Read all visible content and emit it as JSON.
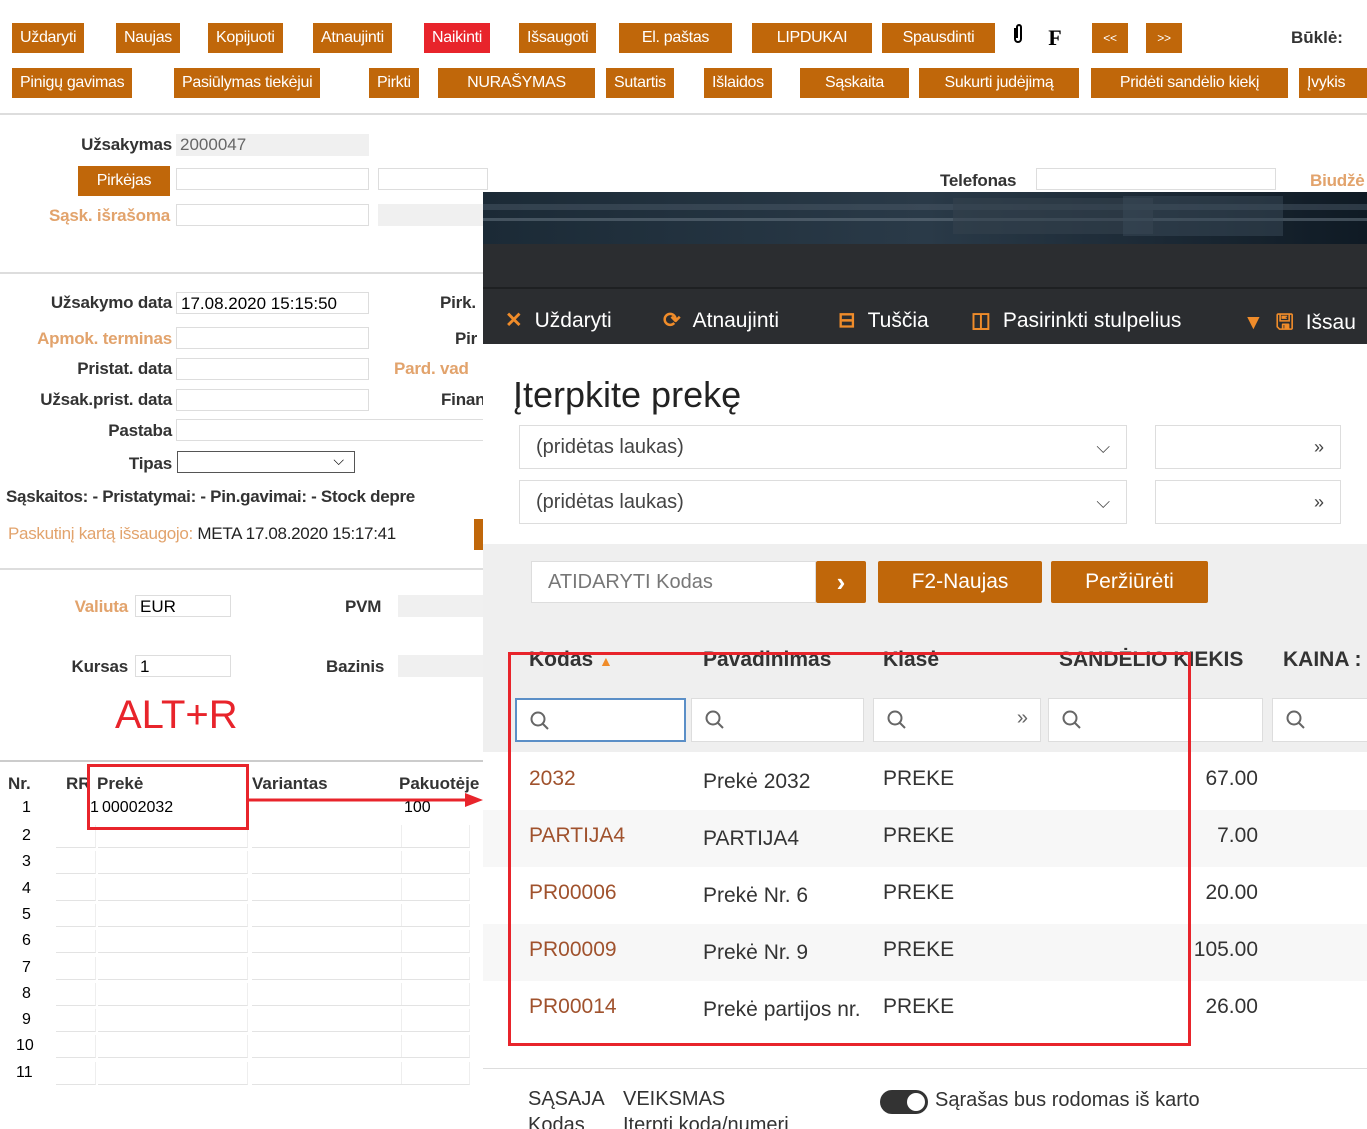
{
  "toolbar1": {
    "buttons": [
      "Uždaryti",
      "Naujas",
      "Kopijuoti",
      "Atnaujinti",
      "Naikinti",
      "Išsaugoti",
      "El. paštas",
      "LIPDUKAI",
      "Spausdinti"
    ],
    "file_icon": "F",
    "prev": "<<",
    "next": ">>",
    "status_label": "Būklė:"
  },
  "toolbar2": {
    "buttons": [
      "Pinigų gavimas",
      "Pasiūlymas tiekėjui",
      "Pirkti",
      "NURAŠYMAS",
      "Sutartis",
      "Išlaidos",
      "Sąskaita",
      "Sukurti judėjimą",
      "Pridėti sandėlio kiekį",
      "Įvykis"
    ]
  },
  "form": {
    "order_label": "Užsakymas",
    "order_value": "2000047",
    "buyer_button": "Pirkėjas",
    "invoice_to_label": "Sąsk. išrašoma",
    "phone_label": "Telefonas",
    "budget_label": "Biudžė",
    "order_date_label": "Užsakymo data",
    "order_date_value": "17.08.2020 15:15:50",
    "payment_terms_label": "Apmok. terminas",
    "delivery_date_label": "Pristat. data",
    "order_delivery_date_label": "Užsak.prist. data",
    "note_label": "Pastaba",
    "type_label": "Tipas",
    "purchase_label_1": "Pirk.",
    "purchase_label_2": "Pir",
    "seller_label": "Pard. vad",
    "finance_label": "Finan",
    "summary_line": "Sąskaitos: - Pristatymai: - Pin.gavimai: - Stock depre",
    "saved_label": "Paskutinį kartą išsaugojo:",
    "saved_value": "META 17.08.2020 15:17:41",
    "currency_label": "Valiuta",
    "currency_value": "EUR",
    "vat_label": "PVM",
    "rate_label": "Kursas",
    "rate_value": "1",
    "base_label": "Bazinis",
    "shortcut": "ALT+R"
  },
  "rows_grid": {
    "headers": [
      "Nr.",
      "RR",
      "Prekė",
      "Variantas",
      "Pakuotėje"
    ],
    "row1": {
      "nr": "1",
      "rr": "1",
      "item": "00002032",
      "pack": "100"
    },
    "numbers": [
      "2",
      "3",
      "4",
      "5",
      "6",
      "7",
      "8",
      "9",
      "10",
      "11"
    ]
  },
  "modal": {
    "tools": [
      "Uždaryti",
      "Atnaujinti",
      "Tuščia",
      "Pasirinkti stulpelius",
      "Išsau"
    ],
    "title": "Įterpkite prekę",
    "added_field_1": "(pridėtas laukas)",
    "added_field_2": "(pridėtas laukas)",
    "code_placeholder": "ATIDARYTI Kodas",
    "new_button": "F2-Naujas",
    "preview_button": "Peržiūrėti",
    "columns": [
      "Kodas",
      "Pavadinimas",
      "Klasė",
      "SANDĖLIO KIEKIS",
      "KAINA :"
    ],
    "rows": [
      {
        "code": "2032",
        "name": "Prekė 2032",
        "class": "PREKE",
        "qty": "67.00"
      },
      {
        "code": "PARTIJA4",
        "name": "PARTIJA4",
        "class": "PREKE",
        "qty": "7.00"
      },
      {
        "code": "PR00006",
        "name": "Prekė Nr. 6",
        "class": "PREKE",
        "qty": "20.00"
      },
      {
        "code": "PR00009",
        "name": "Prekė Nr. 9",
        "class": "PREKE",
        "qty": "105.00"
      },
      {
        "code": "PR00014",
        "name": "Prekė partijos nr.",
        "class": "PREKE",
        "qty": "26.00"
      }
    ],
    "footer_label_1": "SĄSAJA",
    "footer_label_2": "VEIKSMAS",
    "footer_sub_1": "Kodas",
    "footer_sub_2": "Įterpti kodą/numerį",
    "toggle_label": "Sąrašas bus rodomas iš karto"
  },
  "colors": {
    "accent": "#c0670a",
    "danger": "#e8242b",
    "highlight": "#e8242b",
    "dark": "#2b2d30"
  }
}
